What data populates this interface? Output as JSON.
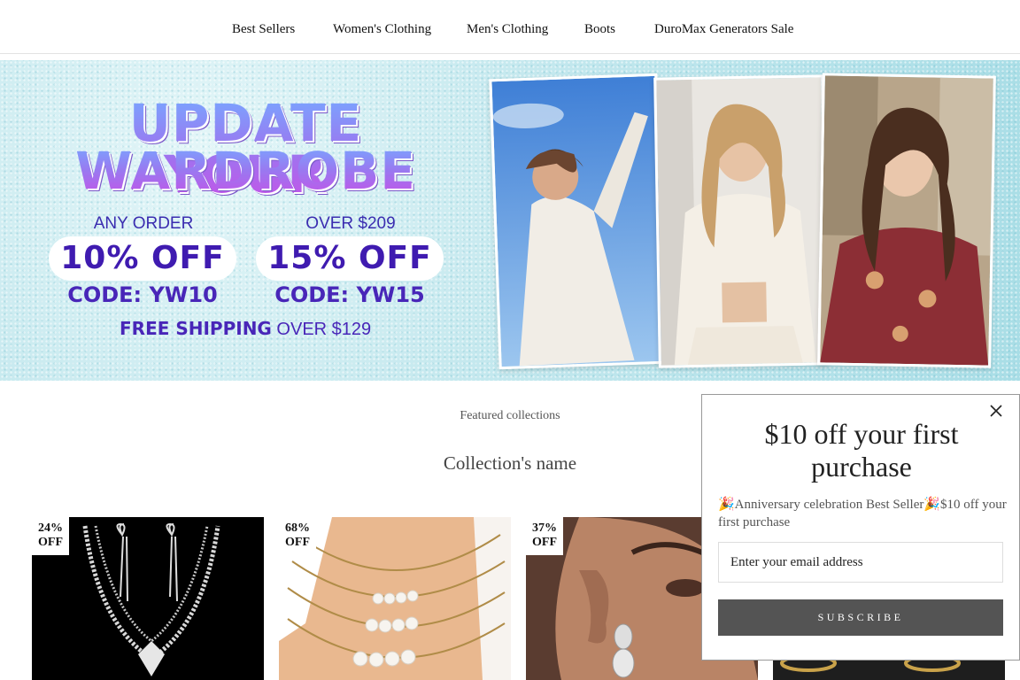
{
  "nav": {
    "items": [
      "Best Sellers",
      "Women's Clothing",
      "Men's Clothing",
      "Boots",
      "DuroMax Generators Sale"
    ]
  },
  "banner": {
    "headline_line1": "UPDATE YOUR",
    "headline_line2": "WARDROBE",
    "offers": [
      {
        "caption": "ANY ORDER",
        "discount": "10% OFF",
        "code": "CODE: YW10"
      },
      {
        "caption": "OVER $209",
        "discount": "15% OFF",
        "code": "CODE: YW15"
      }
    ],
    "shipping_bold": "FREE SHIPPING",
    "shipping_rest": "OVER $129"
  },
  "collections": {
    "featured_label": "Featured collections",
    "collection_name": "Collection's name",
    "products": [
      {
        "badge_pct": "24%",
        "badge_off": "OFF"
      },
      {
        "badge_pct": "68%",
        "badge_off": "OFF"
      },
      {
        "badge_pct": "37%",
        "badge_off": "OFF"
      }
    ]
  },
  "popup": {
    "title": "$10 off your first purchase",
    "description": "🎉Anniversary celebration Best Seller🎉$10 off your first purchase",
    "email_placeholder": "Enter your email address",
    "subscribe_label": "SUBSCRIBE"
  },
  "icons": {
    "close": "close-icon",
    "celebration": "party-popper-icon"
  },
  "colors": {
    "banner_text": "#4826b8",
    "subscribe_bg": "#545454",
    "banner_bg": "#a8dde6"
  }
}
